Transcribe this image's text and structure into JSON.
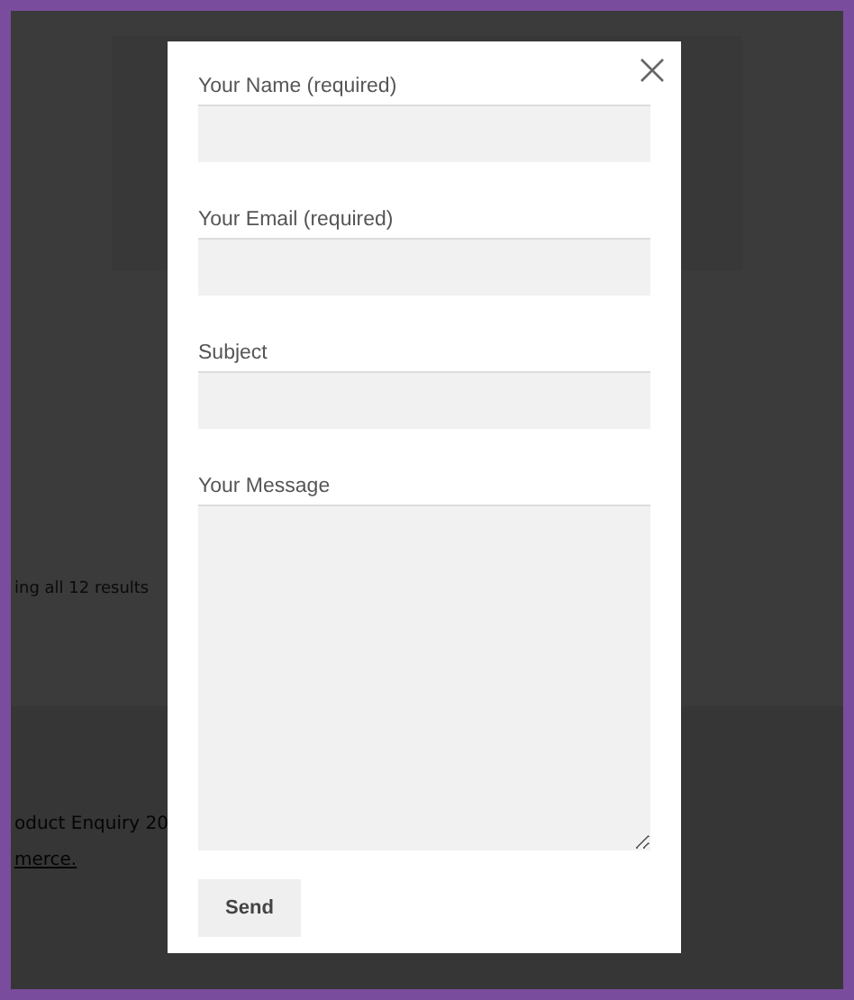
{
  "background_page": {
    "results_text": "ing all 12 results",
    "footer_text": "oduct Enquiry 20",
    "footer_link": "merce."
  },
  "modal": {
    "fields": [
      {
        "label": "Your Name (required)",
        "kind": "input"
      },
      {
        "label": "Your Email (required)",
        "kind": "input"
      },
      {
        "label": "Subject",
        "kind": "input"
      },
      {
        "label": "Your Message",
        "kind": "textarea"
      }
    ],
    "submit_button": "Send"
  }
}
